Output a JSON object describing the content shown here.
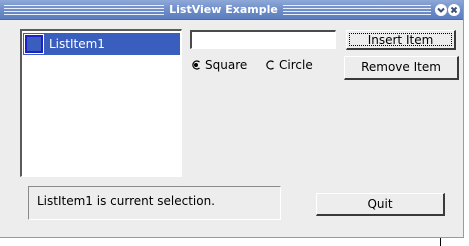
{
  "window": {
    "title": "ListView Example"
  },
  "list": {
    "items": [
      {
        "label": "ListItem1",
        "icon": "square-icon",
        "selected": true
      }
    ]
  },
  "text_input": {
    "value": "",
    "placeholder": ""
  },
  "buttons": {
    "insert_label": "Insert Item",
    "remove_label": "Remove Item",
    "quit_label": "Quit"
  },
  "shape_options": {
    "square_label": "Square",
    "circle_label": "Circle",
    "selected": "Square"
  },
  "status": {
    "text": "ListItem1 is current selection."
  },
  "colors": {
    "title_bar": "#6c8cc8",
    "selection": "#3a5ebd",
    "window_bg": "#ededed"
  }
}
